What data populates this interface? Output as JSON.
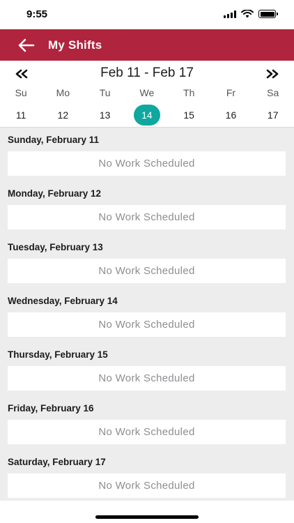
{
  "status_bar": {
    "time": "9:55",
    "icons": [
      "signal-icon",
      "wifi-icon",
      "battery-icon"
    ]
  },
  "header": {
    "title": "My Shifts",
    "back_icon": "arrow-left-icon",
    "background_color": "#b0243e"
  },
  "week_nav": {
    "range": "Feb 11 - Feb 17",
    "prev_icon": "double-chevron-left-icon",
    "next_icon": "double-chevron-right-icon",
    "days": [
      {
        "abbr": "Su",
        "num": "11"
      },
      {
        "abbr": "Mo",
        "num": "12"
      },
      {
        "abbr": "Tu",
        "num": "13"
      },
      {
        "abbr": "We",
        "num": "14"
      },
      {
        "abbr": "Th",
        "num": "15"
      },
      {
        "abbr": "Fr",
        "num": "16"
      },
      {
        "abbr": "Sa",
        "num": "17"
      }
    ],
    "selected_day": "14",
    "selected_color": "#0fa79e"
  },
  "schedule": [
    {
      "heading": "Sunday, February 11",
      "status": "No Work Scheduled"
    },
    {
      "heading": "Monday, February 12",
      "status": "No Work Scheduled"
    },
    {
      "heading": "Tuesday, February 13",
      "status": "No Work Scheduled"
    },
    {
      "heading": "Wednesday, February 14",
      "status": "No Work Scheduled"
    },
    {
      "heading": "Thursday, February 15",
      "status": "No Work Scheduled"
    },
    {
      "heading": "Friday, February 16",
      "status": "No Work Scheduled"
    },
    {
      "heading": "Saturday, February 17",
      "status": "No Work Scheduled"
    }
  ]
}
